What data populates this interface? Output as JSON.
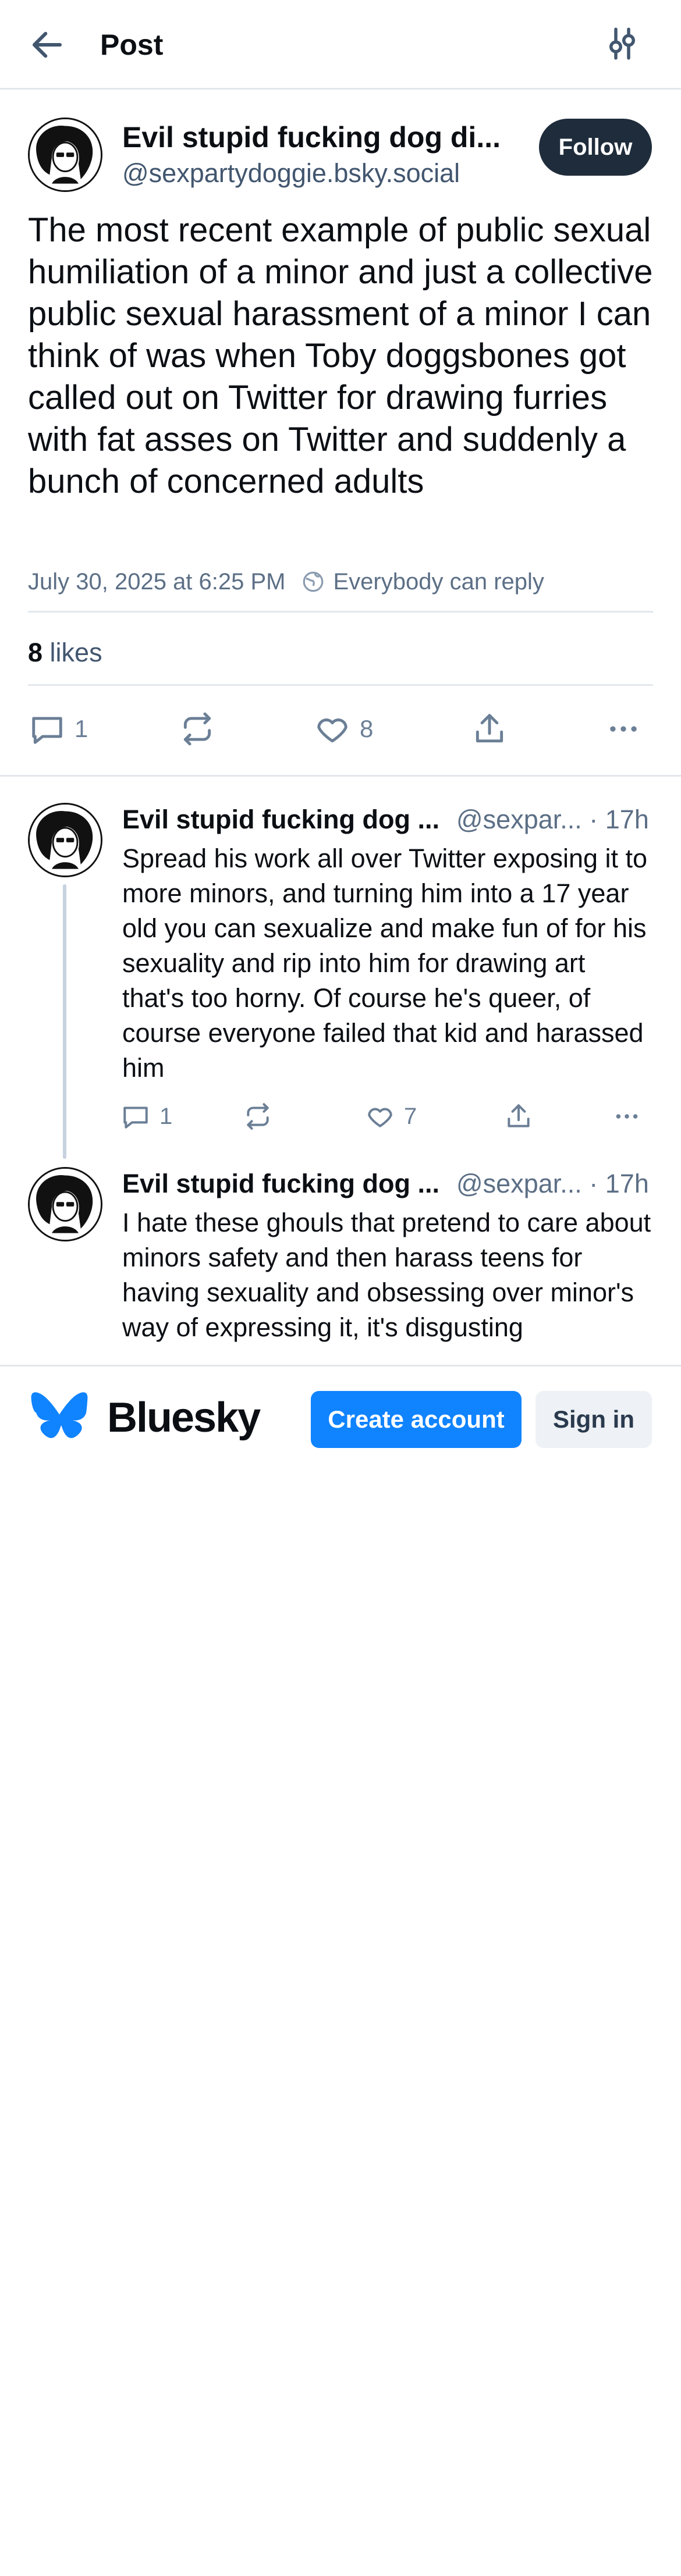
{
  "header": {
    "title": "Post",
    "back_icon": "arrow-left-icon",
    "filter_icon": "sliders-icon"
  },
  "post": {
    "author_name": "Evil stupid fucking dog di...",
    "author_handle": "@sexpartydoggie.bsky.social",
    "follow_label": "Follow",
    "text": "The most recent example of public sexual humiliation of a minor and just a collective public sexual harassment of a minor I can think of was when Toby doggsbones got called out on Twitter for drawing furries with fat asses on Twitter and suddenly a bunch of concerned adults",
    "timestamp": "July 30, 2025 at 6:25 PM",
    "reply_setting": "Everybody can reply",
    "likes_count": "8",
    "likes_label": "likes",
    "actions": {
      "reply_count": "1",
      "like_count": "8"
    }
  },
  "replies": [
    {
      "author_name": "Evil stupid fucking dog ...",
      "author_handle": "@sexpar...",
      "time": "· 17h",
      "text": "Spread his work all over Twitter exposing it to more minors, and turning him into a 17 year old you can sexualize and make fun of for his sexuality and rip into him for drawing art that's too horny. Of course he's queer, of course everyone failed that kid and harassed him",
      "reply_count": "1",
      "like_count": "7"
    },
    {
      "author_name": "Evil stupid fucking dog ...",
      "author_handle": "@sexpar...",
      "time": "· 17h",
      "text": "I hate these ghouls that pretend to care about minors safety and then harass teens for having sexuality and obsessing over minor's way of expressing it, it's disgusting"
    }
  ],
  "footer": {
    "brand": "Bluesky",
    "create_account_label": "Create account",
    "sign_in_label": "Sign in"
  },
  "colors": {
    "accent": "#1083fe",
    "follow_bg": "#1f2c3b",
    "muted": "#5c6f86"
  }
}
